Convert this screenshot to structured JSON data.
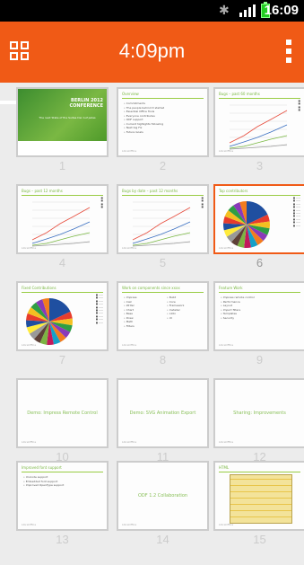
{
  "status_bar": {
    "time": "16:09",
    "icons": [
      "bluetooth-icon",
      "signal-icon",
      "battery-icon"
    ]
  },
  "app_bar": {
    "title": "4:09pm",
    "accent_color": "#f05a16"
  },
  "slides": [
    {
      "number": "1",
      "kind": "title",
      "title": "BERLIN 2012 CONFERENCE",
      "subtitle": "The next State of the Suites Der Auf jedes",
      "selected": false
    },
    {
      "number": "2",
      "kind": "bullets",
      "title": "Overview",
      "bullets": [
        "Commitments",
        "The people behind it started",
        "Essential Office Tools",
        "Everyone contributes",
        "ODF support",
        "Current highlights following",
        "Next big Fix",
        "Future Goals"
      ],
      "selected": false
    },
    {
      "number": "3",
      "kind": "line",
      "title": "Bugs – past 60 months",
      "selected": false
    },
    {
      "number": "4",
      "kind": "line",
      "title": "Bugs – past 12 months",
      "selected": false
    },
    {
      "number": "5",
      "kind": "line",
      "title": "Bugs by date – past 12 months",
      "selected": false
    },
    {
      "number": "6",
      "kind": "pie",
      "title": "Top contributors",
      "selected": true
    },
    {
      "number": "7",
      "kind": "pie",
      "title": "Fixed Contributions",
      "selected": false
    },
    {
      "number": "8",
      "kind": "bullets2",
      "title": "Work on components since xxxx",
      "bullets": [
        "Impress",
        "Calc",
        "Writer",
        "Chart",
        "Base",
        "Draw",
        "Math",
        "Filters"
      ],
      "bullets_b": [
        "Build",
        "Core",
        "Framework",
        "Installer",
        "L10n",
        "UI"
      ],
      "selected": false
    },
    {
      "number": "9",
      "kind": "bullets",
      "title": "Feature Work",
      "bullets": [
        "Impress remote control",
        "Performance",
        "Layout",
        "Import filters",
        "Templates",
        "Security"
      ],
      "selected": false
    },
    {
      "number": "10",
      "kind": "section",
      "title": "Demo: Impress Remote Control",
      "selected": false
    },
    {
      "number": "11",
      "kind": "section",
      "title": "Demo: SVG Animation Export",
      "selected": false
    },
    {
      "number": "12",
      "kind": "section",
      "title": "Sharing: Improvements",
      "selected": false
    },
    {
      "number": "13",
      "kind": "bullets",
      "title": "Improved font support",
      "bullets": [
        "Unicode support",
        "Embedded font support",
        "Improved OpenType support"
      ],
      "selected": false
    },
    {
      "number": "14",
      "kind": "section",
      "title": "ODF 1.2 Collaboration",
      "selected": false
    },
    {
      "number": "15",
      "kind": "grid",
      "title": "HTML",
      "selected": false
    }
  ]
}
